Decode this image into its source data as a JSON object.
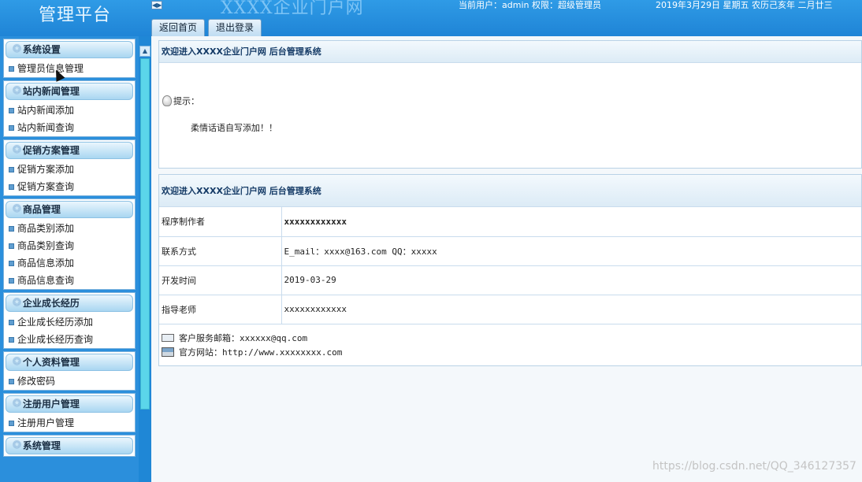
{
  "header": {
    "brand": "管理平台",
    "site_title": "XXXX企业门户网",
    "user_info": "当前用户：admin 权限：超级管理员",
    "datetime": "2019年3月29日 星期五 农历己亥年 二月廿三",
    "buttons": {
      "home": "返回首页",
      "logout": "退出登录"
    }
  },
  "sidebar": {
    "groups": [
      {
        "title": "系统设置",
        "items": [
          "管理员信息管理"
        ]
      },
      {
        "title": "站内新闻管理",
        "items": [
          "站内新闻添加",
          "站内新闻查询"
        ]
      },
      {
        "title": "促销方案管理",
        "items": [
          "促销方案添加",
          "促销方案查询"
        ]
      },
      {
        "title": "商品管理",
        "items": [
          "商品类别添加",
          "商品类别查询",
          "商品信息添加",
          "商品信息查询"
        ]
      },
      {
        "title": "企业成长经历",
        "items": [
          "企业成长经历添加",
          "企业成长经历查询"
        ]
      },
      {
        "title": "个人资料管理",
        "items": [
          "修改密码"
        ]
      },
      {
        "title": "注册用户管理",
        "items": [
          "注册用户管理"
        ]
      },
      {
        "title": "系统管理",
        "items": []
      }
    ]
  },
  "main": {
    "panel1": {
      "title": "欢迎进入XXXX企业门户网 后台管理系统",
      "tip_label": "提示：",
      "tip_message": "柔情话语自写添加！！"
    },
    "panel2": {
      "title": "欢迎进入XXXX企业门户网 后台管理系统",
      "rows": [
        {
          "label": "程序制作者",
          "value": "xxxxxxxxxxxx"
        },
        {
          "label": "联系方式",
          "value": "E_mail：xxxx@163.com QQ：xxxxx"
        },
        {
          "label": "开发时间",
          "value": "2019-03-29"
        },
        {
          "label": "指导老师",
          "value": "xxxxxxxxxxxx"
        }
      ],
      "email_line": "客户服务邮箱：xxxxxx@qq.com",
      "website_line": "官方网站：http://www.xxxxxxxx.com"
    }
  },
  "watermark": "https://blog.csdn.net/QQ_346127357"
}
